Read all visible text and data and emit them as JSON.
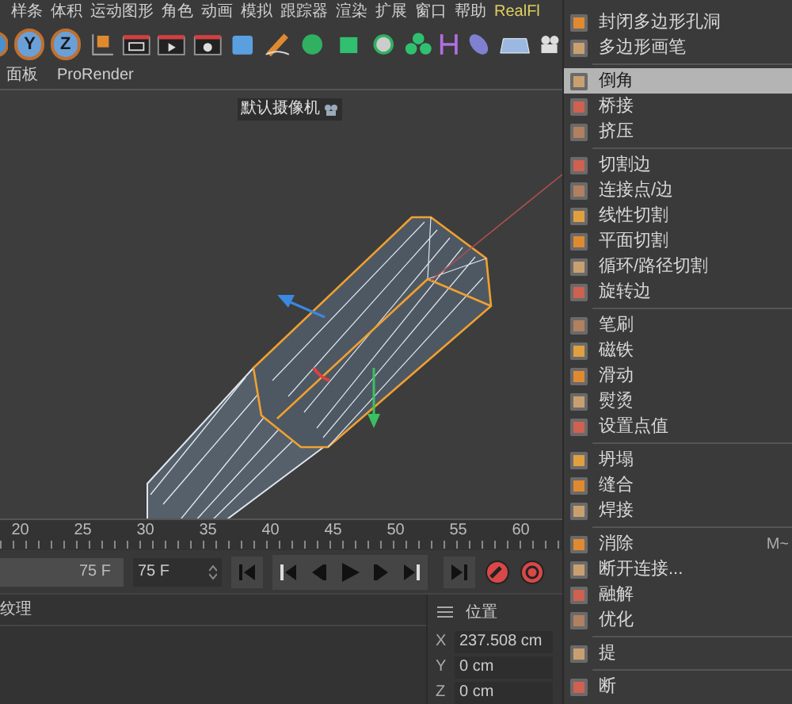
{
  "menu_bar": {
    "items": [
      "样条",
      "体积",
      "运动图形",
      "角色",
      "动画",
      "模拟",
      "跟踪器",
      "渲染",
      "扩展",
      "窗口",
      "帮助",
      "RealFl"
    ]
  },
  "toolbar": {
    "axis_locks": [
      "Y",
      "Z"
    ]
  },
  "viewport": {
    "menu": [
      "面板",
      "ProRender"
    ],
    "camera_label": "默认摄像机"
  },
  "timeline": {
    "ticks": [
      "20",
      "25",
      "30",
      "35",
      "40",
      "45",
      "50",
      "55",
      "60"
    ]
  },
  "playback": {
    "end_frame": "75 F",
    "current_frame": "75 F"
  },
  "material_panel": {
    "title": "纹理"
  },
  "attributes": {
    "title": "位置",
    "fields": [
      {
        "axis": "X",
        "value": "237.508 cm"
      },
      {
        "axis": "Y",
        "value": "0 cm"
      },
      {
        "axis": "Z",
        "value": "0 cm"
      }
    ]
  },
  "tool_menu": {
    "groups": [
      [
        {
          "label": "封闭多边形孔洞",
          "selected": false
        },
        {
          "label": "多边形画笔",
          "selected": false
        }
      ],
      [
        {
          "label": "倒角",
          "selected": true
        },
        {
          "label": "桥接",
          "selected": false
        },
        {
          "label": "挤压",
          "selected": false
        }
      ],
      [
        {
          "label": "切割边",
          "selected": false
        },
        {
          "label": "连接点/边",
          "selected": false
        },
        {
          "label": "线性切割",
          "selected": false
        },
        {
          "label": "平面切割",
          "selected": false
        },
        {
          "label": "循环/路径切割",
          "selected": false
        },
        {
          "label": "旋转边",
          "selected": false
        }
      ],
      [
        {
          "label": "笔刷",
          "selected": false
        },
        {
          "label": "磁铁",
          "selected": false
        },
        {
          "label": "滑动",
          "selected": false
        },
        {
          "label": "熨烫",
          "selected": false
        },
        {
          "label": "设置点值",
          "selected": false
        }
      ],
      [
        {
          "label": "坍塌",
          "selected": false
        },
        {
          "label": "缝合",
          "selected": false
        },
        {
          "label": "焊接",
          "selected": false
        }
      ],
      [
        {
          "label": "消除",
          "selected": false,
          "shortcut": "M~"
        },
        {
          "label": "断开连接...",
          "selected": false
        },
        {
          "label": "融解",
          "selected": false
        },
        {
          "label": "优化",
          "selected": false
        }
      ],
      [
        {
          "label": "提",
          "selected": false
        }
      ],
      [
        {
          "label": "断",
          "selected": false
        }
      ]
    ]
  }
}
